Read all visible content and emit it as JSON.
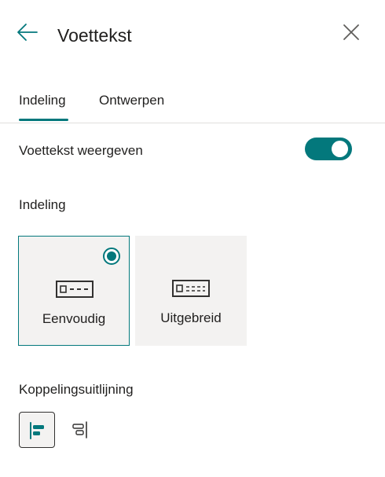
{
  "panel": {
    "title": "Voettekst",
    "back_icon": "arrow-left-icon",
    "close_icon": "close-icon"
  },
  "tabs": [
    {
      "label": "Indeling",
      "selected": true
    },
    {
      "label": "Ontwerpen",
      "selected": false
    }
  ],
  "show_footer": {
    "label": "Voettekst weergeven",
    "enabled": true
  },
  "layout": {
    "label": "Indeling",
    "options": [
      {
        "label": "Eenvoudig",
        "selected": true,
        "icon": "footer-simple-icon"
      },
      {
        "label": "Uitgebreid",
        "selected": false,
        "icon": "footer-extended-icon"
      }
    ]
  },
  "link_alignment": {
    "label": "Koppelingsuitlijning",
    "options": [
      {
        "icon": "align-left-icon",
        "selected": true
      },
      {
        "icon": "align-right-icon",
        "selected": false
      }
    ]
  },
  "colors": {
    "accent": "#03787c",
    "card_bg": "#f3f2f1",
    "text": "#201f1e",
    "divider": "#e1dfdd"
  }
}
